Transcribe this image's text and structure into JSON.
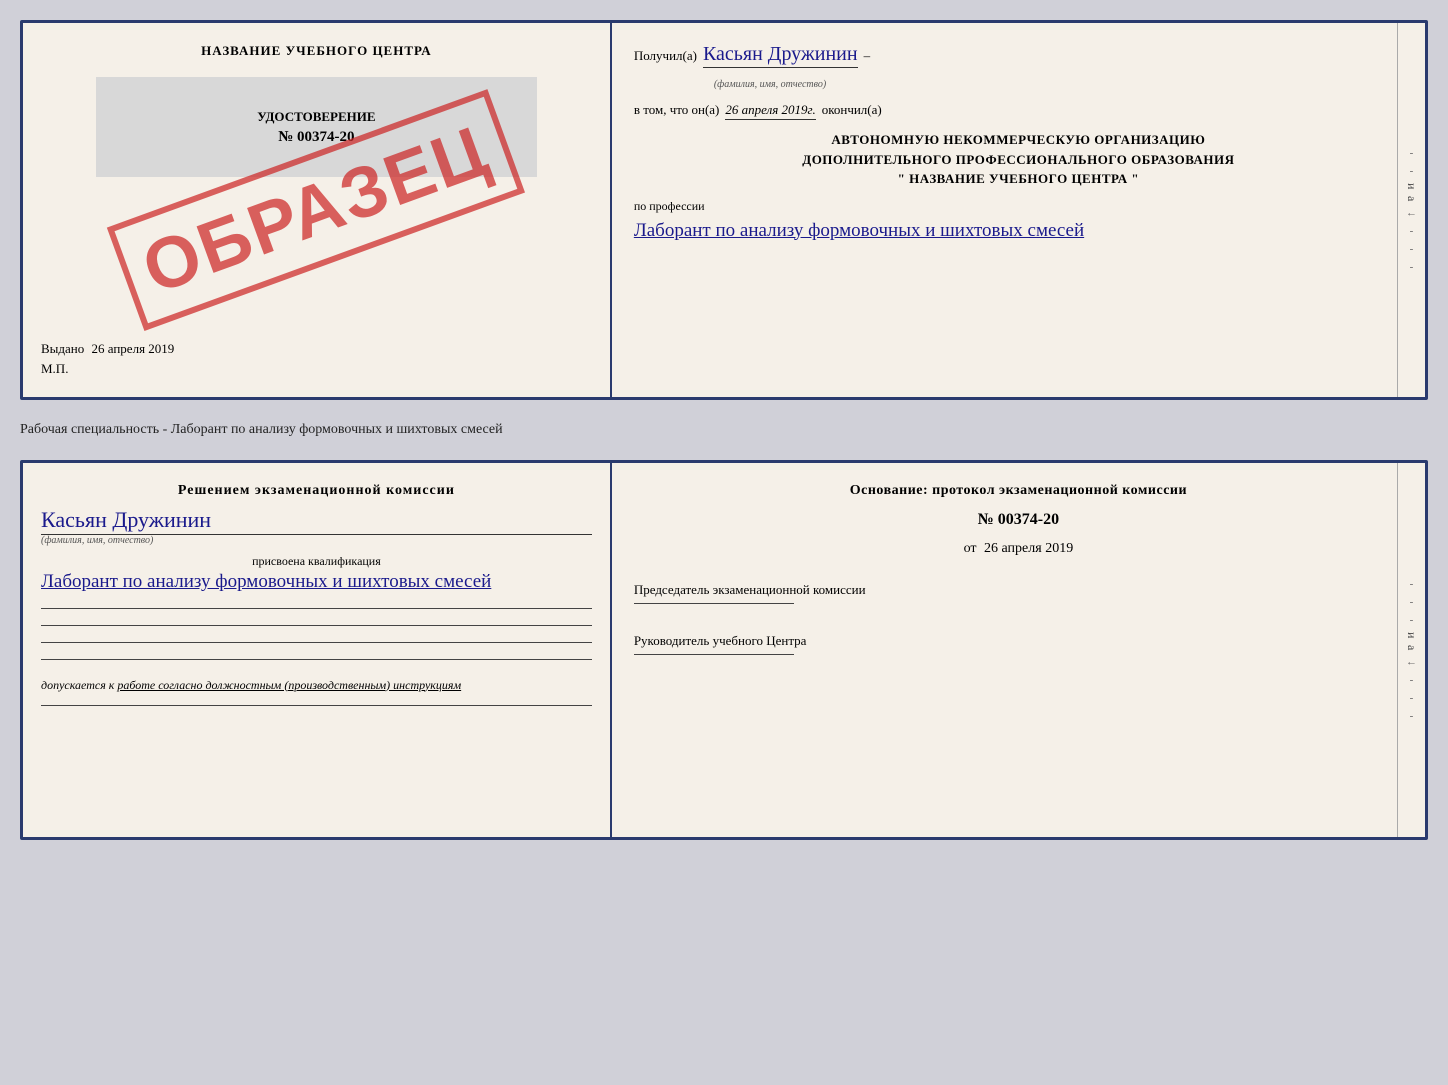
{
  "top_doc": {
    "left": {
      "title": "НАЗВАНИЕ УЧЕБНОГО ЦЕНТРА",
      "stamp": "ОБРАЗЕЦ",
      "udost_title": "УДОСТОВЕРЕНИЕ",
      "udost_number": "№ 00374-20",
      "vydano": "Выдано",
      "vydano_date": "26 апреля 2019",
      "mp": "М.П."
    },
    "right": {
      "poluchil_label": "Получил(a)",
      "poluchil_value": "Касьян Дружинин",
      "fio_subtitle": "(фамилия, имя, отчество)",
      "dash": "–",
      "v_tom_label": "в том, что он(а)",
      "date_value": "26 апреля 2019г.",
      "okonchil": "окончил(а)",
      "center_line1": "АВТОНОМНУЮ НЕКОММЕРЧЕСКУЮ ОРГАНИЗАЦИЮ",
      "center_line2": "ДОПОЛНИТЕЛЬНОГО ПРОФЕССИОНАЛЬНОГО ОБРАЗОВАНИЯ",
      "center_line3": "\"   НАЗВАНИЕ УЧЕБНОГО ЦЕНТРА   \"",
      "po_professii": "по профессии",
      "profession_value": "Лаборант по анализу формовочных и шихтовых смесей",
      "sidebar_items": [
        "-",
        "-",
        "и",
        "а",
        "←",
        "-",
        "-",
        "-"
      ]
    }
  },
  "separator": {
    "text": "Рабочая специальность - Лаборант по анализу формовочных и шихтовых смесей"
  },
  "bottom_doc": {
    "left": {
      "komissia_title": "Решением экзаменационной комиссии",
      "name_value": "Касьян Дружинин",
      "name_subtitle": "(фамилия, имя, отчество)",
      "prisvoena_label": "присвоена квалификация",
      "kvali_value": "Лаборант по анализу формовочных и шихтовых смесей",
      "dopuskaetsya_label": "допускается к",
      "dopuskaetsya_value": "работе согласно должностным (производственным) инструкциям"
    },
    "right": {
      "osnovanie_title": "Основание: протокол экзаменационной комиссии",
      "protocol_number": "№ 00374-20",
      "ot_label": "от",
      "ot_date": "26 апреля 2019",
      "predsedatel_label": "Председатель экзаменационной комиссии",
      "rukovoditel_label": "Руководитель учебного Центра",
      "sidebar_items": [
        "-",
        "-",
        "-",
        "и",
        "а",
        "←",
        "-",
        "-",
        "-"
      ]
    }
  }
}
